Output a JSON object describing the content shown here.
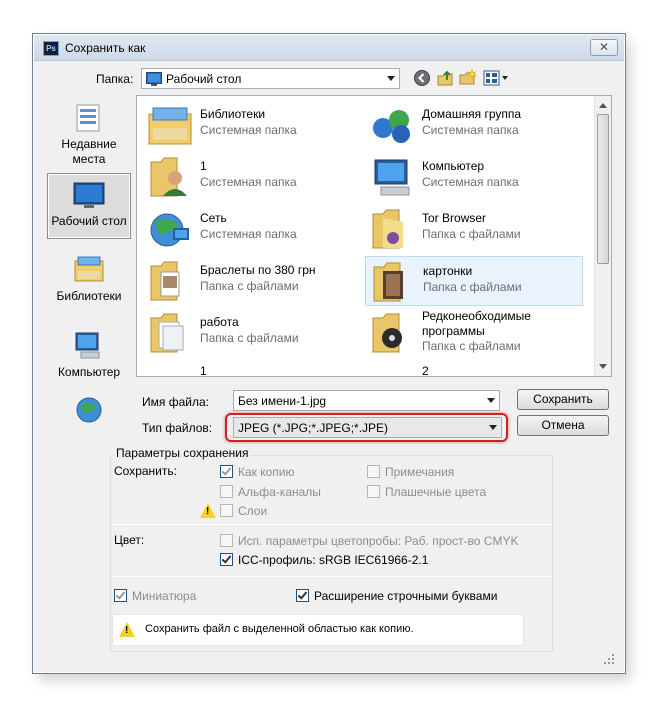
{
  "window": {
    "title": "Сохранить как",
    "app_icon": "Ps",
    "close_label": "✕"
  },
  "location": {
    "label": "Папка:",
    "value": "Рабочий стол"
  },
  "toolbar_icons": [
    "back-icon",
    "up-folder-icon",
    "new-folder-icon",
    "view-menu-icon"
  ],
  "places": [
    {
      "label": "Недавние места",
      "icon": "recent-places-icon"
    },
    {
      "label": "Рабочий стол",
      "icon": "desktop-icon"
    },
    {
      "label": "Библиотеки",
      "icon": "libraries-icon"
    },
    {
      "label": "Компьютер",
      "icon": "computer-icon"
    },
    {
      "label": "",
      "icon": "network-icon"
    }
  ],
  "files": [
    {
      "name": "Библиотеки",
      "type": "Системная папка",
      "icon": "libraries-icon"
    },
    {
      "name": "Домашняя группа",
      "type": "Системная папка",
      "icon": "homegroup-icon"
    },
    {
      "name": "1",
      "type": "Системная папка",
      "icon": "user-folder-icon"
    },
    {
      "name": "Компьютер",
      "type": "Системная папка",
      "icon": "computer-icon"
    },
    {
      "name": "Сеть",
      "type": "Системная папка",
      "icon": "network-icon"
    },
    {
      "name": "Tor Browser",
      "type": "Папка с файлами",
      "icon": "folder-icon"
    },
    {
      "name": "Браслеты по 380 грн",
      "type": "Папка с файлами",
      "icon": "folder-icon"
    },
    {
      "name": "картонки",
      "type": "Папка с файлами",
      "icon": "folder-icon"
    },
    {
      "name": "работа",
      "type": "Папка с файлами",
      "icon": "folder-icon"
    },
    {
      "name": "Редконеобходимые программы",
      "type": "Папка с файлами",
      "icon": "folder-icon"
    },
    {
      "name": "1",
      "type": "",
      "icon": "image-file-icon"
    },
    {
      "name": "2",
      "type": "",
      "icon": "image-file-icon"
    }
  ],
  "filename": {
    "label": "Имя файла:",
    "value": "Без имени-1.jpg"
  },
  "filetype": {
    "label": "Тип файлов:",
    "value": "JPEG (*.JPG;*.JPEG;*.JPE)"
  },
  "buttons": {
    "save": "Сохранить",
    "cancel": "Отмена"
  },
  "options": {
    "group_title": "Параметры сохранения",
    "save_label": "Сохранить:",
    "as_copy": "Как копию",
    "notes": "Примечания",
    "alpha": "Альфа-каналы",
    "spot": "Плашечные цвета",
    "layers": "Слои",
    "color_label": "Цвет:",
    "proof": "Исп. параметры цветопробы:  Раб. прост-во CMYK",
    "icc": "ICC-профиль:  sRGB IEC61966-2.1",
    "thumbnail": "Миниатюра",
    "lowercase": "Расширение строчными буквами",
    "warning_note": "Сохранить файл с выделенной областью как копию."
  },
  "colors": {
    "highlight_box": "#d02020",
    "selection": "#e8f3fd",
    "warning": "#f2d229"
  }
}
